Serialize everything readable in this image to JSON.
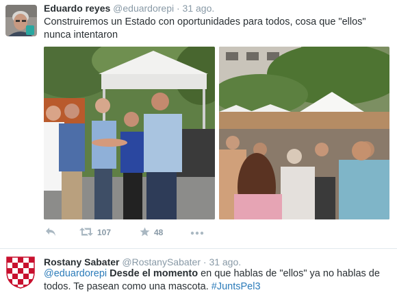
{
  "colors": {
    "link": "#2b7bb9",
    "meta": "#8899a6",
    "icon": "#aab8c2",
    "divider": "#e1e8ed"
  },
  "tweets": [
    {
      "fullname": "Eduardo reyes",
      "username": "@eduardorepi",
      "separator": "·",
      "time": "31 ago.",
      "text": "Construiremos un Estado con oportunidades para todos, cosa que \"ellos\" nunca intentaron",
      "avatar_icon": "profile-photo-gray-hair-man",
      "photos": [
        {
          "icon": "photo-group-candidates-under-white-tent"
        },
        {
          "icon": "photo-crowd-seated-outdoor-square-with-stalls"
        }
      ],
      "actions": {
        "reply_icon": "reply-icon",
        "retweet_icon": "retweet-icon",
        "retweet_count": "107",
        "favorite_icon": "star-icon",
        "favorite_count": "48",
        "more_icon": "more-icon"
      }
    },
    {
      "fullname": "Rostany Sabater",
      "username": "@RostanySabater",
      "separator": "·",
      "time": "31 ago.",
      "avatar_icon": "red-white-checkered-shield-avatar",
      "text_mention": "@eduardorepi",
      "text_bold": "Desde el momento",
      "text_rest": " en que hablas de \"ellos\" ya no hablas de todos. Te pasean como una mascota. ",
      "text_hashtag": "#JuntsPel3"
    }
  ]
}
